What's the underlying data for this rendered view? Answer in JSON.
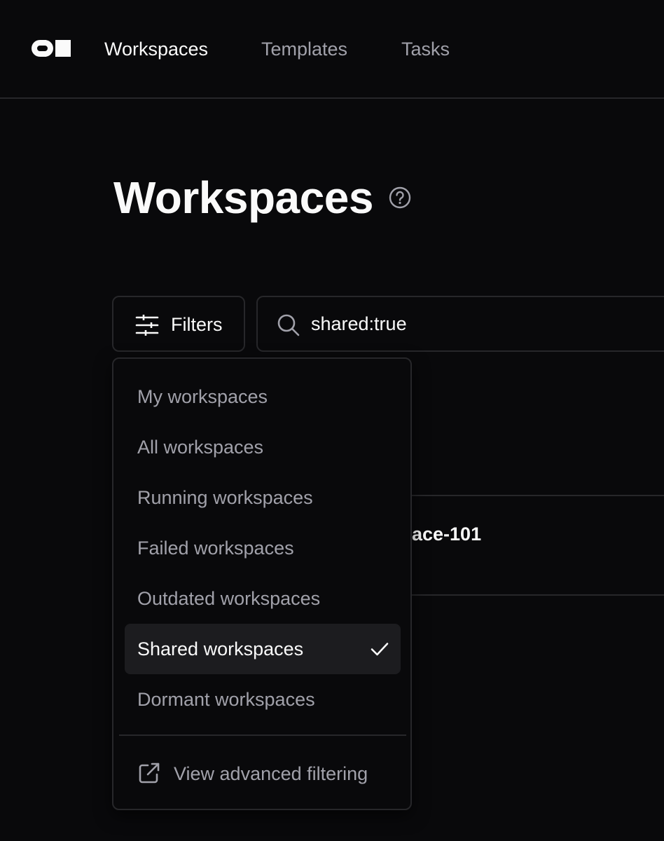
{
  "nav": {
    "items": [
      {
        "label": "Workspaces",
        "active": true
      },
      {
        "label": "Templates",
        "active": false
      },
      {
        "label": "Tasks",
        "active": false
      }
    ]
  },
  "page": {
    "title": "Workspaces"
  },
  "toolbar": {
    "filters_label": "Filters",
    "search_value": "shared:true"
  },
  "table": {
    "row_name_visible_fragment": "ace-101"
  },
  "filter_menu": {
    "items": [
      {
        "label": "My workspaces",
        "selected": false
      },
      {
        "label": "All workspaces",
        "selected": false
      },
      {
        "label": "Running workspaces",
        "selected": false
      },
      {
        "label": "Failed workspaces",
        "selected": false
      },
      {
        "label": "Outdated workspaces",
        "selected": false
      },
      {
        "label": "Shared workspaces",
        "selected": true
      },
      {
        "label": "Dormant workspaces",
        "selected": false
      }
    ],
    "advanced_label": "View advanced filtering"
  },
  "icons": {
    "logo": "coder-logo",
    "help": "question-circle-icon",
    "filters": "sliders-icon",
    "search": "search-icon",
    "check": "check-icon",
    "external": "external-link-icon"
  },
  "colors": {
    "background": "#09090b",
    "border": "#27272a",
    "text_primary": "#fafafa",
    "text_muted": "#a1a1aa",
    "selected_bg": "#1c1c1f"
  }
}
